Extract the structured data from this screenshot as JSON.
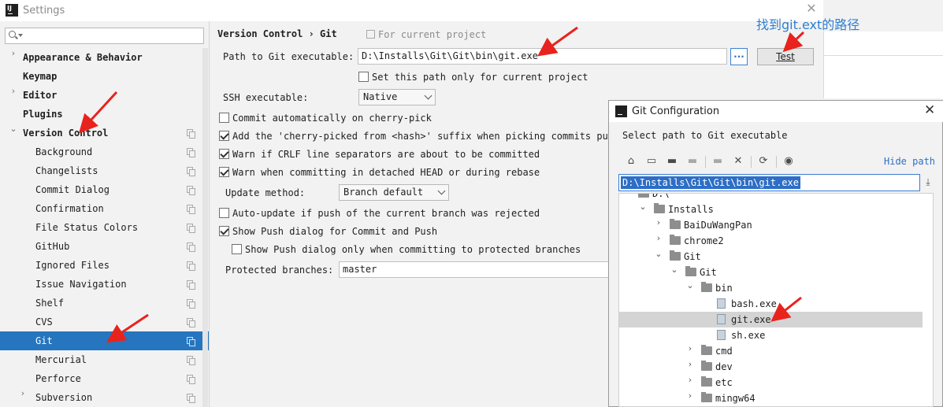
{
  "window": {
    "title": "Settings"
  },
  "sidebar": {
    "items": [
      {
        "label": "Appearance & Behavior",
        "bold": true,
        "arrow": "›",
        "indent": 0
      },
      {
        "label": "Keymap",
        "bold": true,
        "arrow": "",
        "indent": 0
      },
      {
        "label": "Editor",
        "bold": true,
        "arrow": "›",
        "indent": 0
      },
      {
        "label": "Plugins",
        "bold": true,
        "arrow": "",
        "indent": 0
      },
      {
        "label": "Version Control",
        "bold": true,
        "arrow": "⌄",
        "indent": 0,
        "copy": true
      },
      {
        "label": "Background",
        "indent": 1,
        "copy": true
      },
      {
        "label": "Changelists",
        "indent": 1,
        "copy": true
      },
      {
        "label": "Commit Dialog",
        "indent": 1,
        "copy": true
      },
      {
        "label": "Confirmation",
        "indent": 1,
        "copy": true
      },
      {
        "label": "File Status Colors",
        "indent": 1,
        "copy": true
      },
      {
        "label": "GitHub",
        "indent": 1,
        "copy": true
      },
      {
        "label": "Ignored Files",
        "indent": 1,
        "copy": true
      },
      {
        "label": "Issue Navigation",
        "indent": 1,
        "copy": true
      },
      {
        "label": "Shelf",
        "indent": 1,
        "copy": true
      },
      {
        "label": "CVS",
        "indent": 1,
        "copy": true
      },
      {
        "label": "Git",
        "indent": 1,
        "copy": true,
        "selected": true
      },
      {
        "label": "Mercurial",
        "indent": 1,
        "copy": true
      },
      {
        "label": "Perforce",
        "indent": 1,
        "copy": true
      },
      {
        "label": "Subversion",
        "indent": 1,
        "copy": true,
        "arrow": "›"
      }
    ]
  },
  "content": {
    "breadcrumb": "Version Control › Git",
    "scope_note": "For current project",
    "path_label": "Path to Git executable:",
    "path_value": "D:\\Installs\\Git\\Git\\bin\\git.exe",
    "browse_label": "...",
    "test_label": "Test",
    "set_path_only": "Set this path only for current project",
    "ssh_label": "SSH executable:",
    "ssh_value": "Native",
    "commit_auto": "Commit automatically on cherry-pick",
    "cherry_suffix": "Add the 'cherry-picked from <hash>' suffix when picking commits pushe",
    "warn_crlf": "Warn if CRLF line separators are about to be committed",
    "warn_detached": "Warn when committing in detached HEAD or during rebase",
    "update_method_label": "Update method:",
    "update_method_value": "Branch default",
    "auto_update": "Auto-update if push of the current branch was rejected",
    "show_push": "Show Push dialog for Commit and Push",
    "show_push_protected": "Show Push dialog only when committing to protected branches",
    "protected_label": "Protected branches:",
    "protected_value": "master",
    "checks": {
      "set_path_only": false,
      "commit_auto": false,
      "cherry_suffix": true,
      "warn_crlf": true,
      "warn_detached": true,
      "auto_update": false,
      "show_push": true,
      "show_push_protected": false
    }
  },
  "annotation": "找到git.ext的路径",
  "dialog": {
    "title": "Git Configuration",
    "prompt": "Select path to Git executable",
    "hide_path": "Hide path",
    "path": "D:\\Installs\\Git\\Git\\bin\\git.exe",
    "tree": [
      {
        "name": "D:\\",
        "depth": 0,
        "type": "drive",
        "arrow": "⌄"
      },
      {
        "name": "Installs",
        "depth": 1,
        "type": "folder",
        "arrow": "⌄"
      },
      {
        "name": "BaiDuWangPan",
        "depth": 2,
        "type": "folder",
        "arrow": "›"
      },
      {
        "name": "chrome2",
        "depth": 2,
        "type": "folder",
        "arrow": "›"
      },
      {
        "name": "Git",
        "depth": 2,
        "type": "folder",
        "arrow": "⌄"
      },
      {
        "name": "Git",
        "depth": 3,
        "type": "folder",
        "arrow": "⌄"
      },
      {
        "name": "bin",
        "depth": 4,
        "type": "folder",
        "arrow": "⌄"
      },
      {
        "name": "bash.exe",
        "depth": 5,
        "type": "file",
        "arrow": ""
      },
      {
        "name": "git.exe",
        "depth": 5,
        "type": "file",
        "arrow": "",
        "selected": true
      },
      {
        "name": "sh.exe",
        "depth": 5,
        "type": "file",
        "arrow": ""
      },
      {
        "name": "cmd",
        "depth": 4,
        "type": "folder",
        "arrow": "›"
      },
      {
        "name": "dev",
        "depth": 4,
        "type": "folder",
        "arrow": "›"
      },
      {
        "name": "etc",
        "depth": 4,
        "type": "folder",
        "arrow": "›"
      },
      {
        "name": "mingw64",
        "depth": 4,
        "type": "folder",
        "arrow": "›"
      }
    ],
    "toolbar_icons": [
      "home-icon",
      "desktop-icon",
      "project-folder-icon",
      "module-folder-icon",
      "new-folder-icon",
      "delete-icon",
      "refresh-icon",
      "show-hidden-icon"
    ]
  },
  "colors": {
    "selection": "#2675bf",
    "accent_link": "#2f6fc4",
    "annotation_text": "#2f7fd0",
    "arrow_red": "#e8231d"
  }
}
